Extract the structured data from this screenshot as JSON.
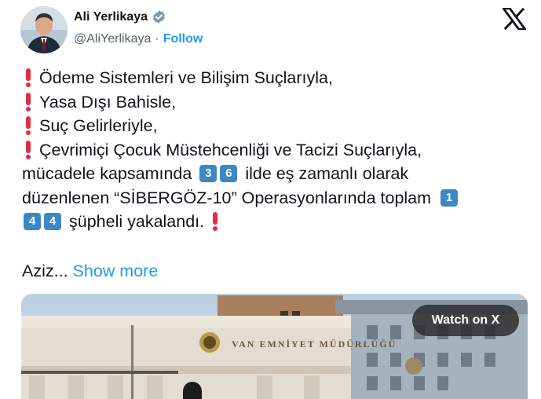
{
  "author": {
    "name": "Ali Yerlikaya",
    "handle": "@AliYerlikaya",
    "separator": "·",
    "follow_label": "Follow"
  },
  "tweet": {
    "lines": [
      "Ödeme Sistemleri ve Bilişim Suçlarıyla,",
      "Yasa Dışı Bahisle,",
      "Suç Gelirleriyle,",
      "Çevrimiçi Çocuk Müstehcenliği ve Tacizi Suçlarıyla,"
    ],
    "line5_prefix": "mücadele kapsamında",
    "line5_digits": [
      "3",
      "6"
    ],
    "line5_suffix": "ilde eş zamanlı olarak",
    "line6_text": "düzenlenen “SİBERGÖZ-10” Operasyonlarında toplam",
    "line6_digit": "1",
    "line7_digits": [
      "4",
      "4"
    ],
    "line7_text": "şüpheli yakalandı.",
    "truncated_text": "Aziz...",
    "show_more_label": "Show more"
  },
  "media": {
    "sign_text": "VAN EMNİYET MÜDÜRLÜĞÜ",
    "watch_label": "Watch on X"
  },
  "colors": {
    "link": "#1d9bf0",
    "keycap": "#3b88c3",
    "exclamation": "#dd2e44"
  }
}
